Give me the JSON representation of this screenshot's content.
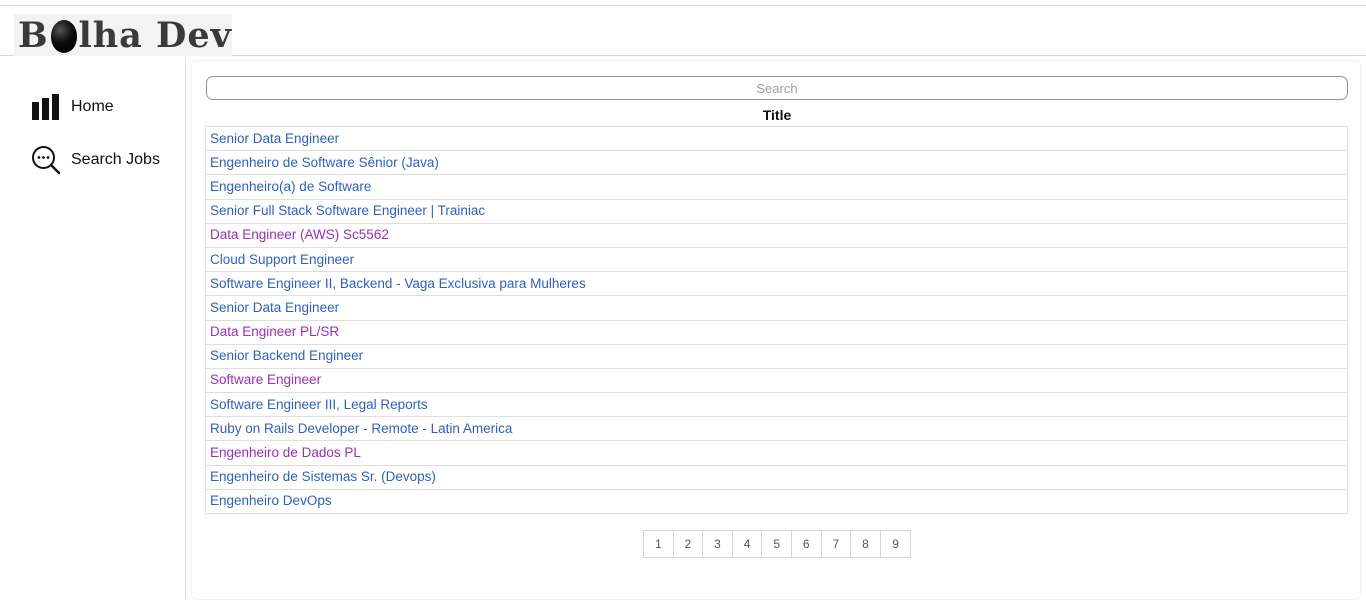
{
  "header": {
    "logo_text_1": "B",
    "logo_text_2": "lha Dev"
  },
  "sidebar": {
    "items": [
      {
        "label": "Home",
        "icon": "bar-chart-icon"
      },
      {
        "label": "Search Jobs",
        "icon": "search-dots-icon"
      }
    ]
  },
  "main": {
    "search": {
      "placeholder": "Search",
      "value": ""
    },
    "table": {
      "column_header": "Title",
      "rows": [
        {
          "title": "Senior Data Engineer",
          "visited": false
        },
        {
          "title": "Engenheiro de Software Sênior (Java)",
          "visited": false
        },
        {
          "title": "Engenheiro(a) de Software",
          "visited": false
        },
        {
          "title": "Senior Full Stack Software Engineer | Trainiac",
          "visited": false
        },
        {
          "title": "Data Engineer (AWS) Sc5562",
          "visited": true
        },
        {
          "title": "Cloud Support Engineer",
          "visited": false
        },
        {
          "title": "Software Engineer II, Backend - Vaga Exclusiva para Mulheres",
          "visited": false
        },
        {
          "title": "Senior Data Engineer",
          "visited": false
        },
        {
          "title": "Data Engineer PL/SR",
          "visited": true
        },
        {
          "title": "Senior Backend Engineer",
          "visited": false
        },
        {
          "title": "Software Engineer",
          "visited": true
        },
        {
          "title": "Software Engineer III, Legal Reports",
          "visited": false
        },
        {
          "title": "Ruby on Rails Developer - Remote - Latin America",
          "visited": false
        },
        {
          "title": "Engenheiro de Dados PL",
          "visited": true
        },
        {
          "title": "Engenheiro de Sistemas Sr. (Devops)",
          "visited": false
        },
        {
          "title": "Engenheiro DevOps",
          "visited": false
        }
      ]
    },
    "pagination": {
      "pages": [
        "1",
        "2",
        "3",
        "4",
        "5",
        "6",
        "7",
        "8",
        "9"
      ]
    }
  },
  "colors": {
    "link": "#2f5fc4",
    "visited_link": "#9b2fb8"
  }
}
